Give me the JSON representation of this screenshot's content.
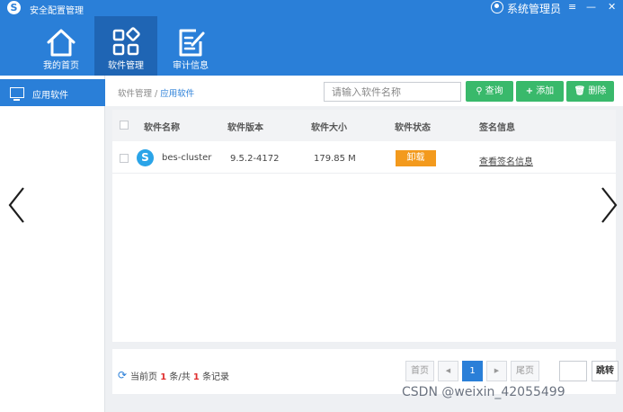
{
  "window": {
    "title": "安全配置管理",
    "user": "系统管理员",
    "controls": {
      "menu": "≡",
      "minimize": "—",
      "close": "✕"
    }
  },
  "nav": {
    "tabs": [
      {
        "label": "我的首页",
        "icon": "home-icon"
      },
      {
        "label": "软件管理",
        "icon": "apps-grid-icon",
        "active": true
      },
      {
        "label": "审计信息",
        "icon": "edit-note-icon"
      }
    ]
  },
  "sidebar": {
    "items": [
      {
        "label": "应用软件",
        "icon": "monitor-icon",
        "active": true
      }
    ]
  },
  "breadcrumb": {
    "parent": "软件管理",
    "separator": "/",
    "current": "应用软件"
  },
  "search": {
    "placeholder": "请输入软件名称",
    "value": ""
  },
  "toolbar": {
    "query_label": "查询",
    "add_label": "添加",
    "delete_label": "删除",
    "colors": {
      "query": "#39b96b",
      "add": "#39b96b",
      "delete": "#39b96b"
    }
  },
  "table": {
    "columns": [
      "软件名称",
      "软件版本",
      "软件大小",
      "软件状态",
      "签名信息"
    ],
    "rows": [
      {
        "name": "bes-cluster",
        "version": "9.5.2-4172",
        "size": "179.85 M",
        "status": "卸载",
        "signature": "查看签名信息"
      }
    ]
  },
  "pagination": {
    "prefix": "当前页",
    "current_count": "1",
    "middle": "条/共",
    "total": "1",
    "suffix": "条记录",
    "first": "首页",
    "prev": "◀",
    "page": "1",
    "next": "▶",
    "last": "尾页",
    "goto_value": "",
    "goto": "跳转"
  },
  "watermark": "CSDN @weixin_42055499",
  "theme": {
    "primary": "#2a7fd8",
    "nav_active": "#1f65b4",
    "status_orange": "#f39a1d",
    "highlight_red": "#e03030"
  }
}
